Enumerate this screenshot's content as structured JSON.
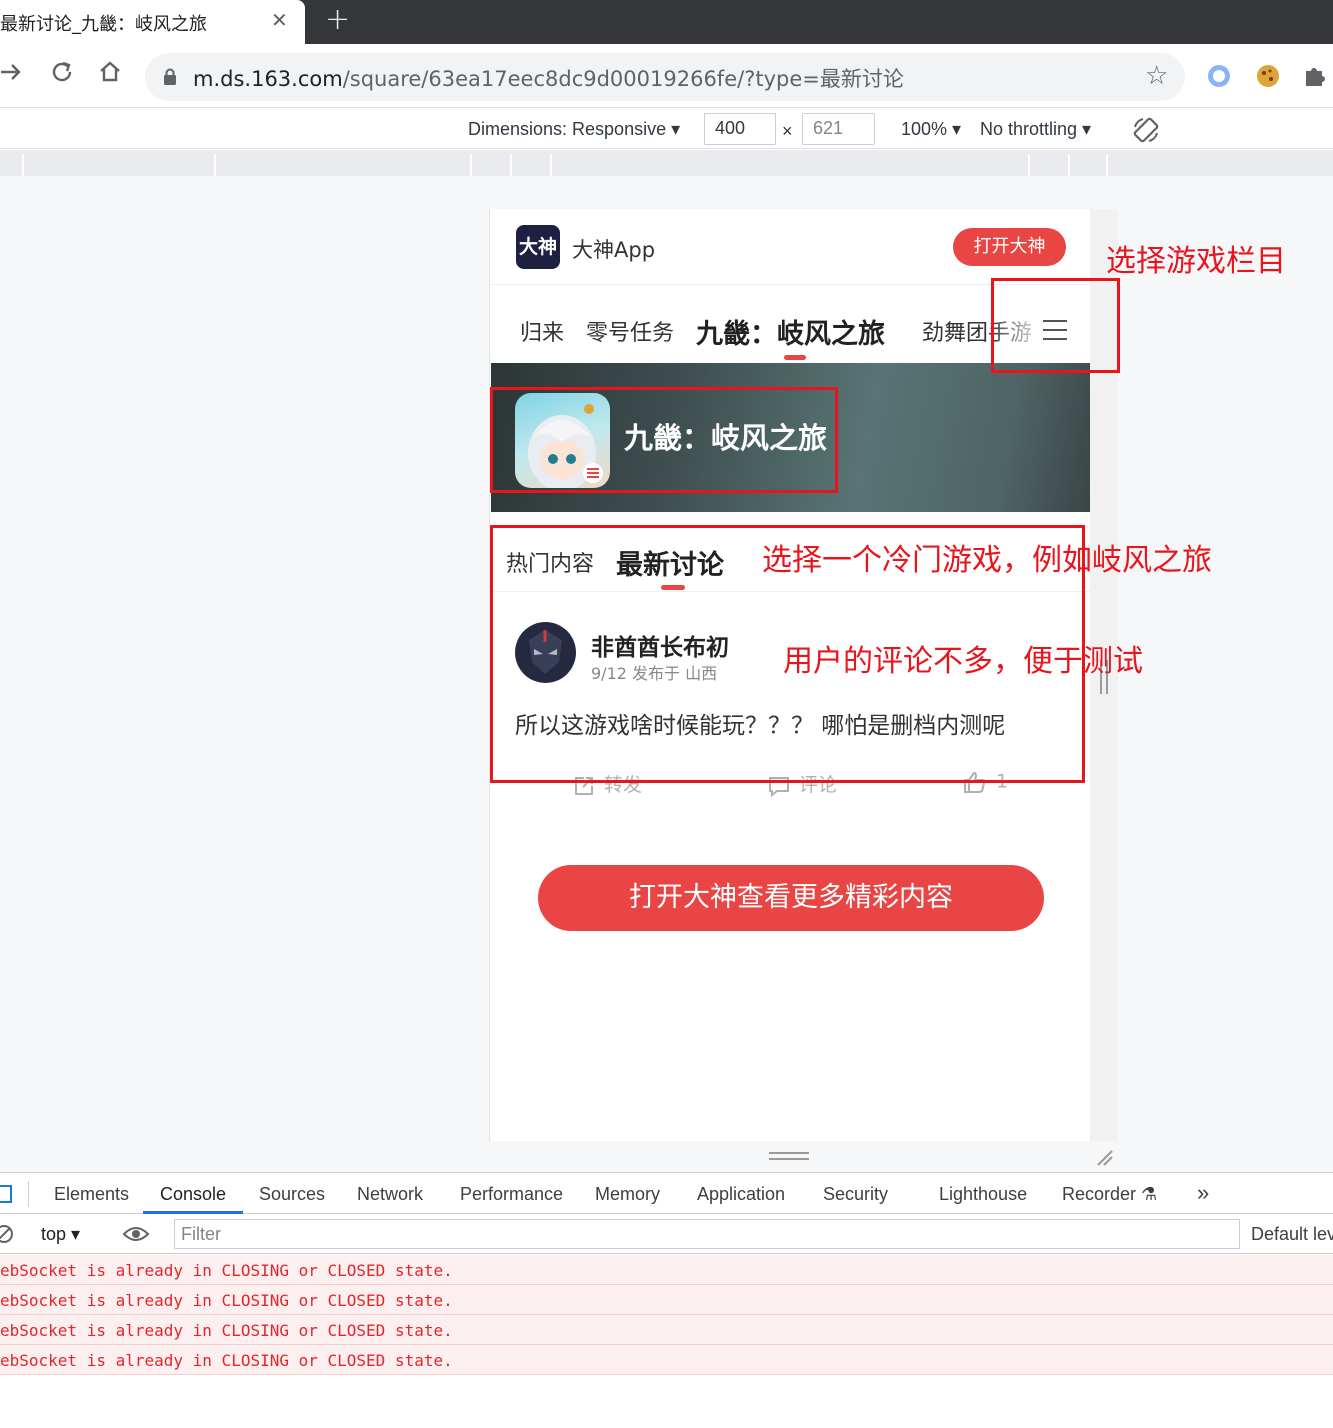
{
  "browser": {
    "tab_title": "最新讨论_九畿：岐风之旅",
    "tab_close": "✕",
    "new_tab": "+",
    "url_host": "m.ds.163.com",
    "url_path": "/square/63ea17eec8dc9d00019266fe/?type=最新讨论"
  },
  "device_toolbar": {
    "dimensions_label": "Dimensions: Responsive ▾",
    "width_value": "400",
    "times": "×",
    "height_value": "621",
    "zoom": "100% ▾",
    "throttling": "No throttling ▾"
  },
  "app": {
    "logo_text": "大神",
    "name": "大神App",
    "open_button": "打开大神",
    "game_tabs": [
      "归来",
      "零号任务",
      "九畿：岐风之旅",
      "劲舞团手游"
    ],
    "active_game_tab": "九畿：岐风之旅",
    "banner_title": "九畿：岐风之旅",
    "content_tabs": {
      "hot": "热门内容",
      "latest": "最新讨论"
    },
    "post": {
      "user": "非酋酋长布初",
      "meta": "9/12 发布于 山西",
      "text": "所以这游戏啥时候能玩？？？ 哪怕是删档内测呢",
      "forward": "转发",
      "comment": "评论",
      "likes": "1"
    },
    "more_button": "打开大神查看更多精彩内容"
  },
  "annotations": {
    "select_column": "选择游戏栏目",
    "select_game": "选择一个冷门游戏，例如岐风之旅",
    "few_comments": "用户的评论不多，便于测试"
  },
  "devtools": {
    "tabs": [
      "Elements",
      "Console",
      "Sources",
      "Network",
      "Performance",
      "Memory",
      "Application",
      "Security",
      "Lighthouse",
      "Recorder ⚗",
      "»"
    ],
    "active_tab": "Console",
    "context": "top ▾",
    "filter_placeholder": "Filter",
    "levels": "Default levels",
    "logs": [
      "ebSocket is already in CLOSING or CLOSED state.",
      "ebSocket is already in CLOSING or CLOSED state.",
      "ebSocket is already in CLOSING or CLOSED state.",
      "ebSocket is already in CLOSING or CLOSED state."
    ]
  },
  "colors": {
    "brand_red": "#e94545",
    "annotation_red": "#e8151c",
    "devtools_blue": "#1a73e8"
  }
}
